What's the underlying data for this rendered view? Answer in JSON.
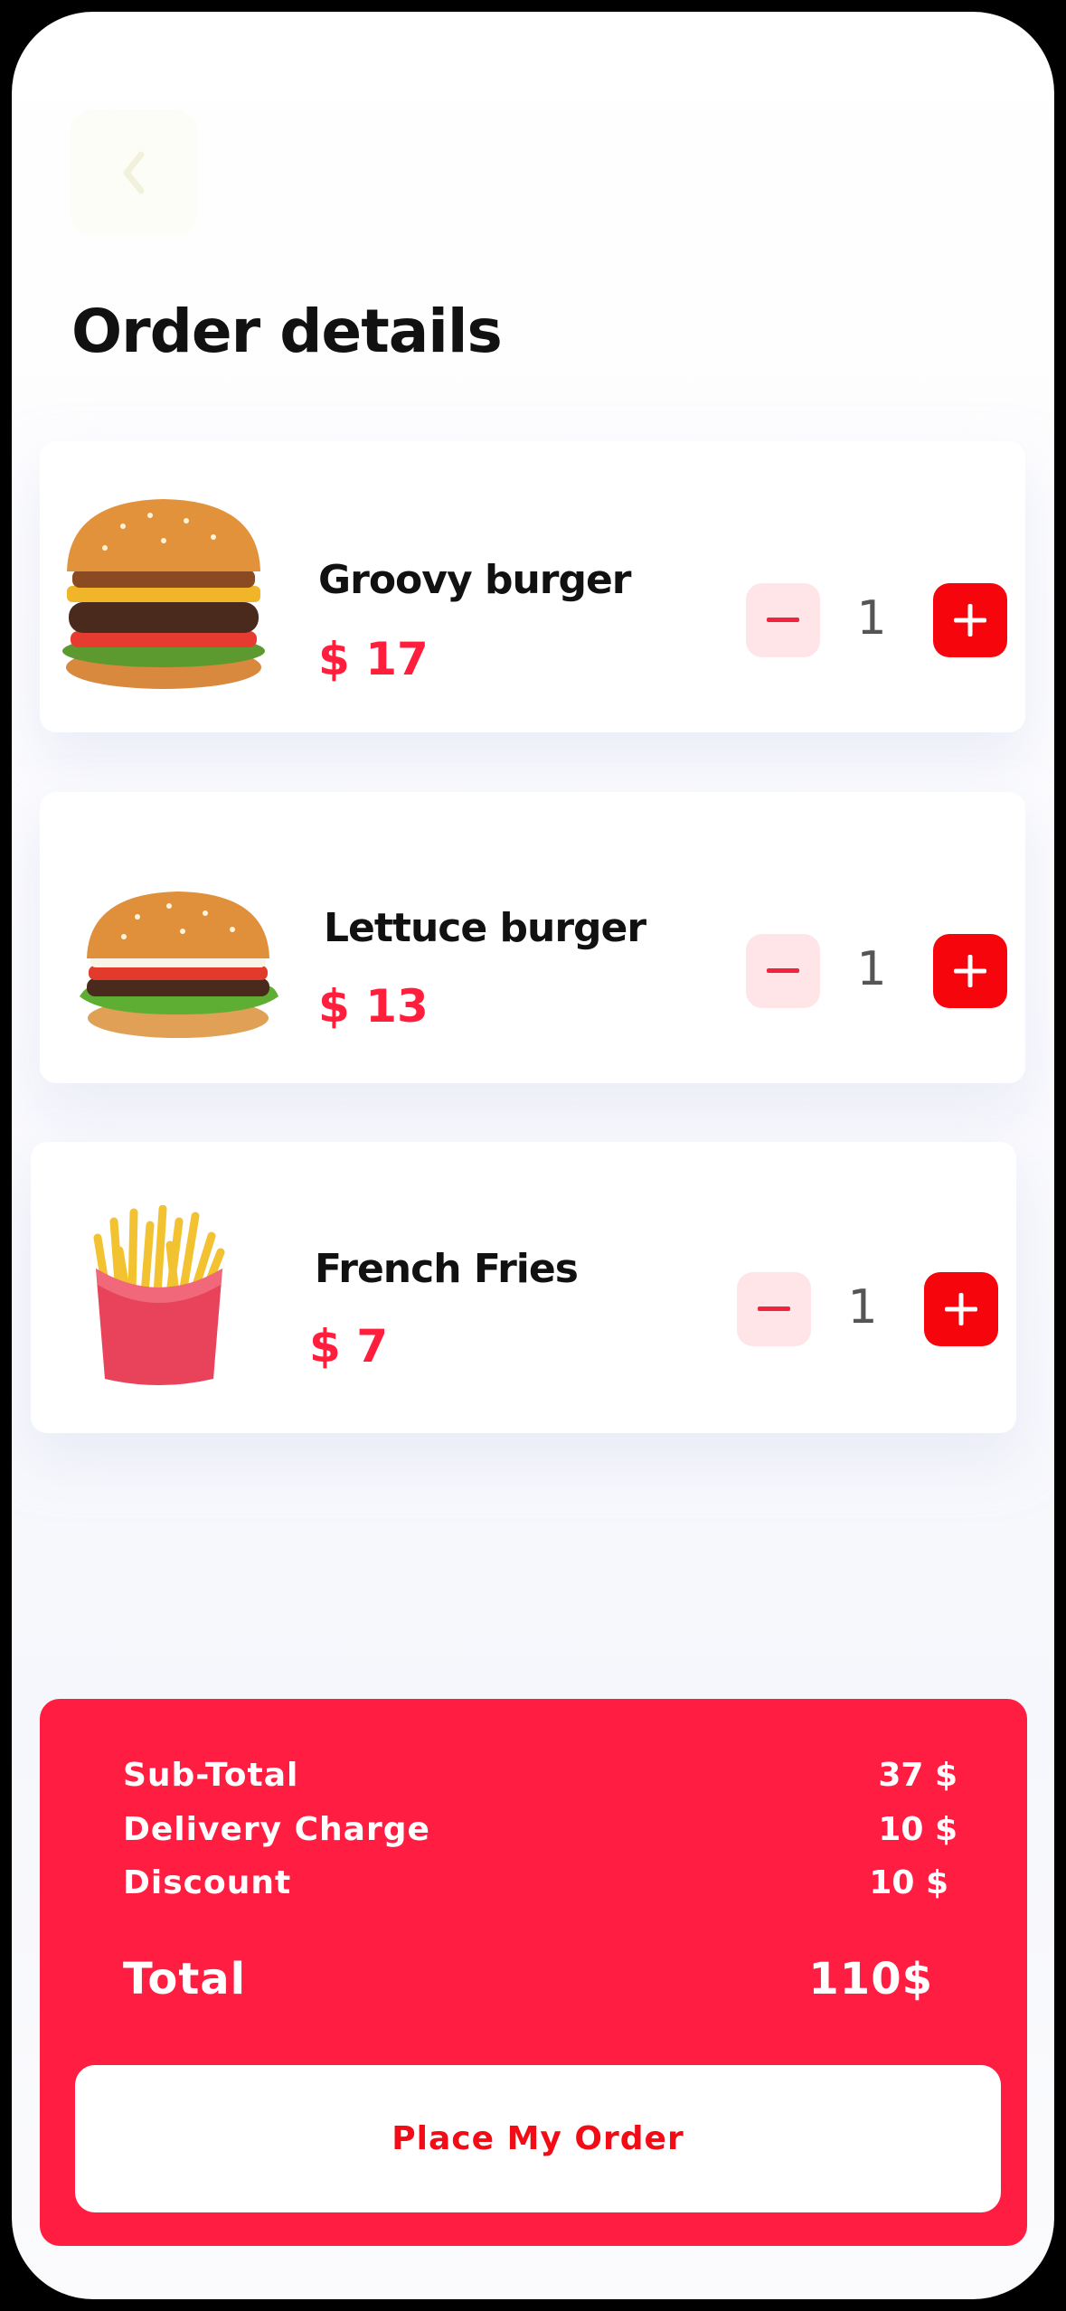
{
  "header": {
    "title": "Order details",
    "back_icon": "chevron-left-icon"
  },
  "items": [
    {
      "name": "Groovy burger",
      "price": "$ 17",
      "quantity": "1",
      "image": "burger-image"
    },
    {
      "name": "Lettuce burger",
      "price": "$ 13",
      "quantity": "1",
      "image": "burger-image"
    },
    {
      "name": "French Fries",
      "price": "$ 7",
      "quantity": "1",
      "image": "fries-image"
    }
  ],
  "summary": {
    "subtotal_label": "Sub-Total",
    "subtotal_value": "37 $",
    "delivery_label": "Delivery Charge",
    "delivery_value": "10 $",
    "discount_label": "Discount",
    "discount_value": "10 $",
    "total_label": "Total",
    "total_value": "110$",
    "button_label": "Place My Order"
  },
  "colors": {
    "accent": "#ff1e42",
    "button_red": "#f6050d",
    "minus_bg": "#ffe5e8"
  }
}
